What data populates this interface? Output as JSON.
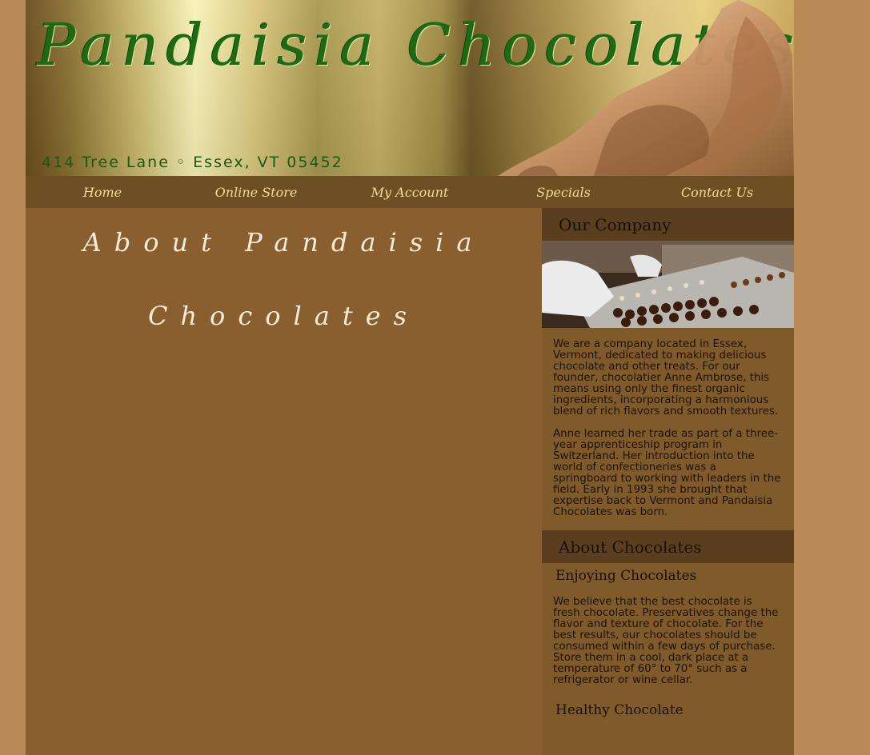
{
  "header": {
    "logo_text": "Pandaisia Chocolates",
    "address": "414 Tree Lane ◦ Essex, VT 05452"
  },
  "nav": {
    "items": [
      "Home",
      "Online Store",
      "My Account",
      "Specials",
      "Contact Us"
    ]
  },
  "main": {
    "title_line1": "About Pandaisia",
    "title_line2": "Chocolates"
  },
  "sidebar": {
    "our_company": {
      "heading": "Our Company",
      "paragraphs": [
        "We are a company located in Essex, Vermont, dedicated to making delicious chocolate and other treats. For our founder, chocolatier Anne Ambrose, this means using only the finest organic ingredients, incorporating a harmonious blend of rich flavors and smooth textures.",
        "Anne learned her trade as part of a three-year apprenticeship program in Switzerland. Her introduction into the world of confectioneries was a springboard to working with leaders in the field. Early in 1993 she brought that expertise back to Vermont and Pandaisia Chocolates was born."
      ]
    },
    "about_chocolates": {
      "heading": "About Chocolates",
      "enjoying_heading": "Enjoying Chocolates",
      "enjoying_text": "We believe that the best chocolate is fresh chocolate. Preservatives change the flavor and texture of chocolate. For the best results, our chocolates should be consumed within a few days of purchase. Store them in a cool, dark place at a temperature of 60° to 70° such as a refrigerator or wine cellar.",
      "healthy_heading": "Healthy Chocolate"
    }
  },
  "colors": {
    "page_bg": "#b98a55",
    "content_bg": "#8a5f30",
    "nav_bg": "#6e4f23",
    "nav_text": "#f1dc97",
    "sidebar_heading_bg": "#5b3e1f",
    "logo_green": "#1e6a13"
  }
}
